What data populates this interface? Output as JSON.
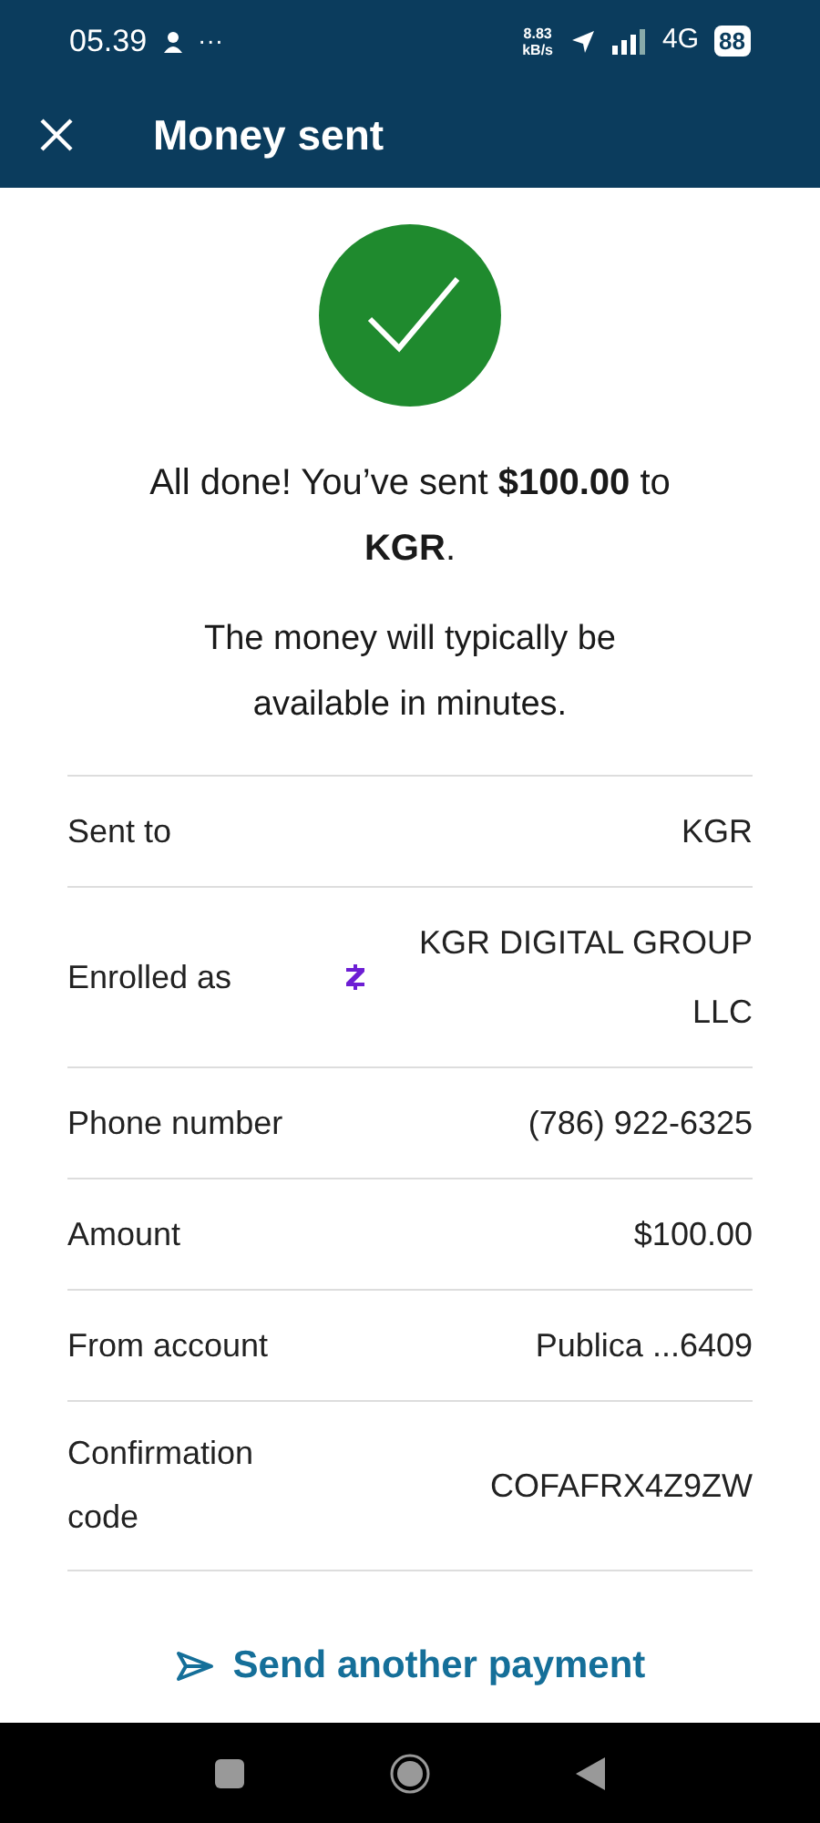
{
  "status_bar": {
    "time": "05.39",
    "dots": "···",
    "speed_value": "8.83",
    "speed_unit": "kB/s",
    "network": "4G",
    "battery": "88"
  },
  "header": {
    "title": "Money sent"
  },
  "message": "All done! You’ve sent **$100.00** to **KGR**.",
  "note": "The money will typically be available in minutes.",
  "details": [
    {
      "label": "Sent to",
      "value": "KGR",
      "kind": "plain"
    },
    {
      "label": "Enrolled as",
      "value": "KGR DIGITAL GROUP LLC",
      "kind": "zelle"
    },
    {
      "label": "Phone number",
      "value": "(786) 922-6325",
      "kind": "plain"
    },
    {
      "label": "Amount",
      "value": "$100.00",
      "kind": "plain"
    },
    {
      "label": "From account",
      "value": "Publica ...6409",
      "kind": "plain"
    },
    {
      "label": "Confirmation code",
      "value": "COFAFRX4Z9ZW",
      "kind": "plain"
    }
  ],
  "action": {
    "label": "Send another payment"
  }
}
